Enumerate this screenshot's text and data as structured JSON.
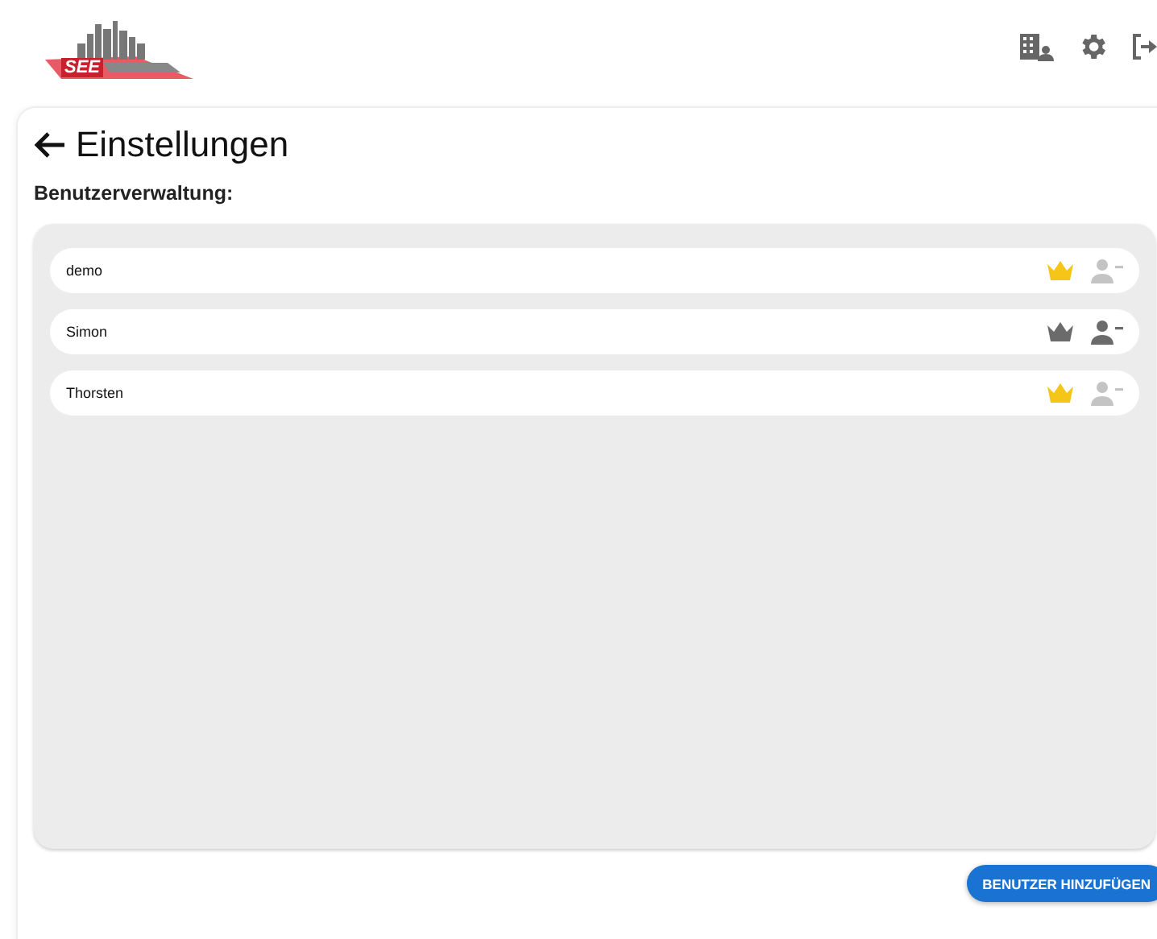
{
  "logo": {
    "text": "SEE"
  },
  "page": {
    "title": "Einstellungen",
    "section": "Benutzerverwaltung:"
  },
  "users": [
    {
      "name": "demo",
      "admin": true,
      "removable": false
    },
    {
      "name": "Simon",
      "admin": false,
      "removable": true
    },
    {
      "name": "Thorsten",
      "admin": true,
      "removable": false
    }
  ],
  "add_button": "BENUTZER HINZUFÜGEN"
}
